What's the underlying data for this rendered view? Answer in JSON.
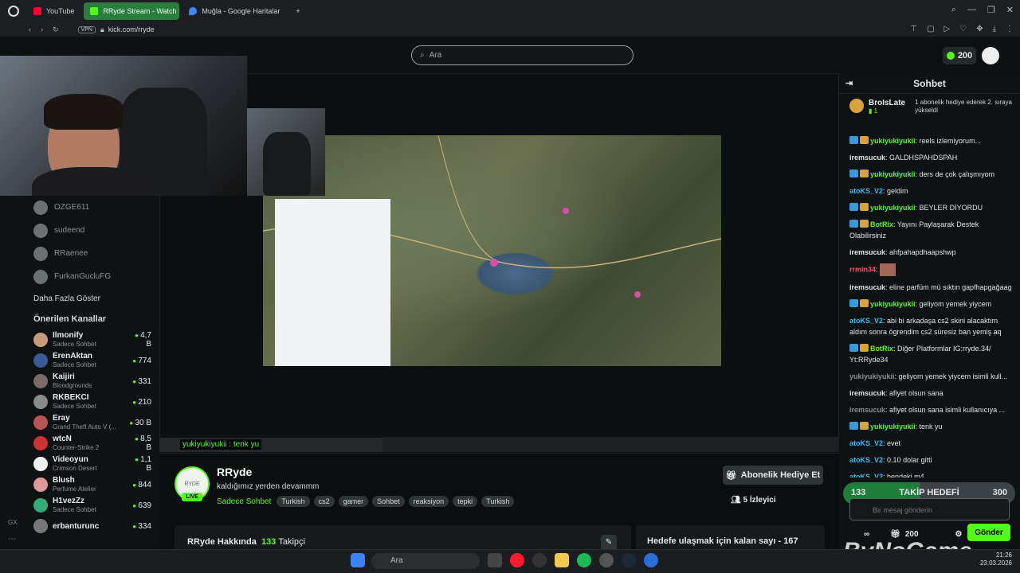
{
  "tabs": [
    {
      "label": "YouTube",
      "color": "#ff0033"
    },
    {
      "label": "RRyde Stream - Watch Li",
      "color": "#53fc18"
    },
    {
      "label": "Muğla - Google Haritalar",
      "color": "#4285f4"
    }
  ],
  "address": {
    "vpn": "VPN",
    "url": "kick.com/rryde"
  },
  "search": {
    "placeholder": "Ara"
  },
  "coins": "200",
  "sidebar": {
    "followed": [
      {
        "name": "OZGE611"
      },
      {
        "name": "sudeend"
      },
      {
        "name": "RRaenee"
      },
      {
        "name": "FurkanGucluFG"
      }
    ],
    "show_more": "Daha Fazla Göster",
    "recommended_title": "Önerilen Kanallar",
    "channels": [
      {
        "name": "Ilmonify",
        "category": "Sadece Sohbet",
        "viewers": "4,7 B"
      },
      {
        "name": "ErenAktan",
        "category": "Sadece Sohbet",
        "viewers": "774"
      },
      {
        "name": "Kaijiri",
        "category": "Bloodgrounds",
        "viewers": "331"
      },
      {
        "name": "RKBEKCI",
        "category": "Sadece Sohbet",
        "viewers": "210"
      },
      {
        "name": "Eray",
        "category": "Grand Theft Auto V (...",
        "viewers": "30 B"
      },
      {
        "name": "wtcN",
        "category": "Counter-Strike 2",
        "viewers": "8,5 B"
      },
      {
        "name": "Videoyun",
        "category": "Crimson Desert",
        "viewers": "1,1 B"
      },
      {
        "name": "Blush",
        "category": "Perfume Atelier",
        "viewers": "844"
      },
      {
        "name": "H1vezZz",
        "category": "Sadece Sohbet",
        "viewers": "639"
      },
      {
        "name": "erbanturunc",
        "category": "",
        "viewers": "334"
      }
    ]
  },
  "overlay_chat": "yukiyukiyukii : tenk yu",
  "stream": {
    "name": "RRyde",
    "title": "kaldığımız yerden devammm",
    "category": "Sadece Sohbet",
    "tags": [
      "Turkish",
      "cs2",
      "gamer",
      "Sohbet",
      "reaksiyon",
      "tepki",
      "Turkish"
    ],
    "subscribe_label": "Abonelik Hediye Et",
    "viewers": "5 İzleyici",
    "about_label": "RRyde Hakkında",
    "followers_count": "133",
    "followers_word": "Takipçi",
    "goal_text": "Hedefe ulaşmak için kalan sayı - 167"
  },
  "chat": {
    "title": "Sohbet",
    "pinned_user": "BroIsLate",
    "pinned_text": "1 abonelik hediye ederek 2. sıraya yükseldi",
    "messages": [
      {
        "user": "yukiyukiyukii",
        "color": "#53fc18",
        "badge": "blue",
        "text": "reels izlemiyorum..."
      },
      {
        "user": "iremsucuk",
        "color": "#e0e3e5",
        "badge": "",
        "text": "GALDHSPAHDSPAH"
      },
      {
        "user": "yukiyukiyukii",
        "color": "#53fc18",
        "badge": "blue",
        "text": "ders de çok çalışmıyom"
      },
      {
        "user": "atoKS_V2",
        "color": "#3ab8f0",
        "badge": "",
        "text": "geldim"
      },
      {
        "user": "yukiyukiyukii",
        "color": "#53fc18",
        "badge": "blue",
        "text": "BEYLER DİYORDU"
      },
      {
        "user": "BotRix",
        "color": "#53fc18",
        "badge": "blue",
        "text": "Yayını Paylaşarak Destek Olabilirsiniz"
      },
      {
        "user": "iremsucuk",
        "color": "#e0e3e5",
        "badge": "",
        "text": "ahfpahapdhaapshwp"
      },
      {
        "user": "rrmin34",
        "color": "#ff4d6d",
        "badge": "",
        "text": ""
      },
      {
        "user": "iremsucuk",
        "color": "#e0e3e5",
        "badge": "",
        "text": "eline parfüm mü sıktın gapfhapgağaag"
      },
      {
        "user": "yukiyukiyukii",
        "color": "#53fc18",
        "badge": "blue",
        "text": "geliyom yemek yiycem"
      },
      {
        "user": "atoKS_V2",
        "color": "#3ab8f0",
        "badge": "",
        "text": "abi bi arkadaşa cs2 skini alacaktım aldım sonra ögrendim cs2 süresiz ban yemiş aq"
      },
      {
        "user": "BotRix",
        "color": "#53fc18",
        "badge": "blue",
        "text": "Diğer Platformlar IG:rryde.34/ Yt:RRyde34"
      },
      {
        "user": "yukiyukiyukii",
        "color": "#8a8f92",
        "badge": "",
        "text": "geliyom yemek yiycem isimli kull..."
      },
      {
        "user": "iremsucuk",
        "color": "#e0e3e5",
        "badge": "",
        "text": "afiyet olsun sana"
      },
      {
        "user": "iremsucuk",
        "color": "#8a8f92",
        "badge": "",
        "text": "afiyet olsun sana isimli kullanıcıya ..."
      },
      {
        "user": "yukiyukiyukii",
        "color": "#53fc18",
        "badge": "blue",
        "text": "tenk yu"
      },
      {
        "user": "atoKS_V2",
        "color": "#3ab8f0",
        "badge": "",
        "text": "evet"
      },
      {
        "user": "atoKS_V2",
        "color": "#3ab8f0",
        "badge": "",
        "text": "0.10 dolar gitti"
      },
      {
        "user": "atoKS_V2",
        "color": "#3ab8f0",
        "badge": "",
        "text": "bendeki m4"
      }
    ],
    "goal": {
      "current": "133",
      "label": "TAKİP HEDEFİ",
      "target": "300",
      "progress": 0.443
    },
    "input_placeholder": "Bir mesaj gönderin",
    "points": "200",
    "send": "Gönder"
  },
  "watermark": "ByNoGame",
  "taskbar": {
    "search": "Ara",
    "time": "21:26",
    "date": "23.03.2026"
  }
}
